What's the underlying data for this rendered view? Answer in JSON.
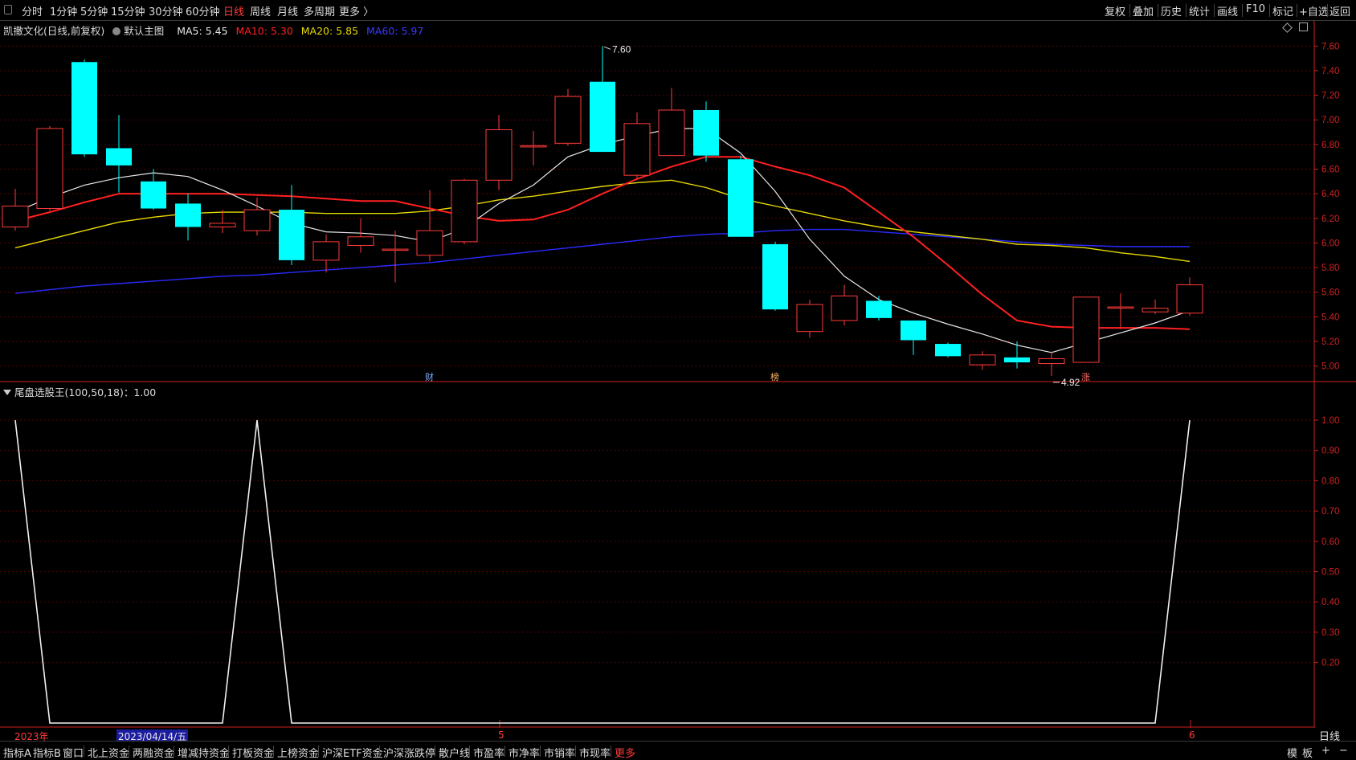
{
  "toolbar": {
    "timeframes": [
      "分时",
      "1分钟",
      "5分钟",
      "15分钟",
      "30分钟",
      "60分钟",
      "日线",
      "周线",
      "月线",
      "多周期",
      "更多 〉"
    ],
    "active_timeframe": "日线",
    "right_items": [
      "复权",
      "叠加",
      "历史",
      "统计",
      "画线",
      "F10",
      "标记",
      "+自选",
      "返回"
    ]
  },
  "info": {
    "stock_label": "凯撒文化(日线,前复权)",
    "main_chart_label": "默认主图",
    "ma5": "MA5: 5.45",
    "ma10": "MA10: 5.30",
    "ma20": "MA20: 5.85",
    "ma60": "MA60: 5.97"
  },
  "indicator": {
    "label": "尾盘选股王(100,50,18)：1.00"
  },
  "colors": {
    "up": "#ff3b3b",
    "down": "#00ffff",
    "ma5": "#e8e8e8",
    "ma10": "#ff2020",
    "ma20": "#e6d800",
    "ma60": "#2a2aff",
    "grid": "#5a0000",
    "axis": "#d02020"
  },
  "chart_data": [
    {
      "type": "candlestick",
      "title": "",
      "ylim": [
        4.88,
        7.7
      ],
      "yticks": [
        "7.60",
        "7.40",
        "7.20",
        "7.00",
        "6.80",
        "6.60",
        "6.40",
        "6.20",
        "6.00",
        "5.80",
        "5.60",
        "5.40",
        "5.20",
        "5.00"
      ],
      "grid": true,
      "candles": [
        {
          "o": 6.13,
          "c": 6.3,
          "h": 6.44,
          "l": 6.1
        },
        {
          "o": 6.28,
          "c": 6.93,
          "h": 6.95,
          "l": 6.26
        },
        {
          "o": 7.47,
          "c": 6.72,
          "h": 7.49,
          "l": 6.7
        },
        {
          "o": 6.77,
          "c": 6.63,
          "h": 7.04,
          "l": 6.41
        },
        {
          "o": 6.5,
          "c": 6.28,
          "h": 6.6,
          "l": 6.27
        },
        {
          "o": 6.32,
          "c": 6.13,
          "h": 6.4,
          "l": 6.02
        },
        {
          "o": 6.13,
          "c": 6.16,
          "h": 6.27,
          "l": 6.08
        },
        {
          "o": 6.1,
          "c": 6.27,
          "h": 6.37,
          "l": 6.06
        },
        {
          "o": 6.27,
          "c": 5.86,
          "h": 6.47,
          "l": 5.82
        },
        {
          "o": 5.86,
          "c": 6.01,
          "h": 6.07,
          "l": 5.76
        },
        {
          "o": 5.98,
          "c": 6.05,
          "h": 6.2,
          "l": 5.92
        },
        {
          "o": 5.95,
          "c": 5.95,
          "h": 6.1,
          "l": 5.68
        },
        {
          "o": 5.9,
          "c": 6.1,
          "h": 6.43,
          "l": 5.85
        },
        {
          "o": 6.01,
          "c": 6.51,
          "h": 6.52,
          "l": 5.99
        },
        {
          "o": 6.51,
          "c": 6.92,
          "h": 7.04,
          "l": 6.43
        },
        {
          "o": 6.79,
          "c": 6.79,
          "h": 6.91,
          "l": 6.63
        },
        {
          "o": 6.81,
          "c": 7.19,
          "h": 7.25,
          "l": 6.79
        },
        {
          "o": 7.31,
          "c": 6.74,
          "h": 7.6,
          "l": 6.74
        },
        {
          "o": 6.55,
          "c": 6.97,
          "h": 7.06,
          "l": 6.52
        },
        {
          "o": 6.71,
          "c": 7.08,
          "h": 7.26,
          "l": 6.71
        },
        {
          "o": 7.08,
          "c": 6.71,
          "h": 7.15,
          "l": 6.66
        },
        {
          "o": 6.68,
          "c": 6.05,
          "h": 6.71,
          "l": 6.05
        },
        {
          "o": 5.99,
          "c": 5.46,
          "h": 6.01,
          "l": 5.45
        },
        {
          "o": 5.28,
          "c": 5.5,
          "h": 5.54,
          "l": 5.23
        },
        {
          "o": 5.37,
          "c": 5.57,
          "h": 5.66,
          "l": 5.33
        },
        {
          "o": 5.53,
          "c": 5.39,
          "h": 5.57,
          "l": 5.37
        },
        {
          "o": 5.37,
          "c": 5.21,
          "h": 5.37,
          "l": 5.09
        },
        {
          "o": 5.18,
          "c": 5.08,
          "h": 5.19,
          "l": 5.07
        },
        {
          "o": 5.01,
          "c": 5.09,
          "h": 5.12,
          "l": 4.97
        },
        {
          "o": 5.07,
          "c": 5.03,
          "h": 5.2,
          "l": 4.98
        },
        {
          "o": 5.02,
          "c": 5.06,
          "h": 5.12,
          "l": 4.92
        },
        {
          "o": 5.03,
          "c": 5.56,
          "h": 5.56,
          "l": 5.03
        },
        {
          "o": 5.48,
          "c": 5.48,
          "h": 5.59,
          "l": 5.3
        },
        {
          "o": 5.44,
          "c": 5.47,
          "h": 5.54,
          "l": 5.42
        },
        {
          "o": 5.43,
          "c": 5.66,
          "h": 5.72,
          "l": 5.41
        }
      ],
      "ma5": [
        6.25,
        6.37,
        6.47,
        6.53,
        6.57,
        6.54,
        6.43,
        6.3,
        6.16,
        6.09,
        6.08,
        6.06,
        6.01,
        6.12,
        6.32,
        6.47,
        6.7,
        6.8,
        6.87,
        6.93,
        6.93,
        6.73,
        6.42,
        6.03,
        5.73,
        5.54,
        5.43,
        5.34,
        5.26,
        5.17,
        5.11,
        5.19,
        5.27,
        5.35,
        5.45
      ],
      "ma10": [
        6.18,
        6.25,
        6.33,
        6.4,
        6.4,
        6.4,
        6.4,
        6.39,
        6.38,
        6.36,
        6.34,
        6.34,
        6.28,
        6.22,
        6.18,
        6.19,
        6.27,
        6.4,
        6.52,
        6.62,
        6.7,
        6.7,
        6.62,
        6.55,
        6.45,
        6.25,
        6.05,
        5.82,
        5.58,
        5.37,
        5.32,
        5.31,
        5.31,
        5.31,
        5.3
      ],
      "ma20": [
        5.96,
        6.03,
        6.1,
        6.17,
        6.21,
        6.24,
        6.25,
        6.25,
        6.25,
        6.24,
        6.24,
        6.24,
        6.26,
        6.3,
        6.35,
        6.38,
        6.42,
        6.46,
        6.49,
        6.51,
        6.45,
        6.36,
        6.3,
        6.24,
        6.18,
        6.13,
        6.09,
        6.06,
        6.03,
        5.99,
        5.98,
        5.96,
        5.92,
        5.89,
        5.85
      ],
      "ma60": [
        5.59,
        5.62,
        5.65,
        5.67,
        5.69,
        5.71,
        5.73,
        5.74,
        5.76,
        5.78,
        5.8,
        5.82,
        5.84,
        5.87,
        5.9,
        5.93,
        5.96,
        5.99,
        6.02,
        6.05,
        6.07,
        6.08,
        6.1,
        6.11,
        6.11,
        6.09,
        6.07,
        6.05,
        6.03,
        6.01,
        5.99,
        5.98,
        5.97,
        5.97,
        5.97
      ],
      "annotations": [
        {
          "label": "7.60",
          "at_index": 17,
          "value": 7.6
        },
        {
          "label": "4.92",
          "at_index": 30,
          "value": 4.92
        }
      ],
      "event_markers": [
        {
          "label": "财",
          "at_index": 12
        },
        {
          "label": "榜",
          "at_index": 22
        },
        {
          "label": "涨",
          "at_index": 31
        }
      ]
    },
    {
      "type": "line",
      "title": "",
      "ylim": [
        0,
        1.0
      ],
      "yticks": [
        "1.00",
        "0.90",
        "0.80",
        "0.70",
        "0.60",
        "0.50",
        "0.40",
        "0.30",
        "0.20"
      ],
      "series": [
        {
          "values": [
            1,
            0,
            0,
            0,
            0,
            0,
            0,
            1,
            0,
            0,
            0,
            0,
            0,
            0,
            0,
            0,
            0,
            0,
            0,
            0,
            0,
            0,
            0,
            0,
            0,
            0,
            0,
            0,
            0,
            0,
            0,
            0,
            0,
            0,
            1
          ]
        }
      ]
    }
  ],
  "date_labels": {
    "year": "2023年",
    "cursor_date": "2023/04/14/五",
    "month_5": "5",
    "month_6": "6"
  },
  "period_label": "日线",
  "bottom_tabs": [
    "指标A",
    "指标B",
    "窗口",
    "北上资金",
    "两融资金",
    "增减持资金",
    "打板资金",
    "上榜资金",
    "沪深ETF资金",
    "沪深涨跌停",
    "散户线",
    "市盈率",
    "市净率",
    "市销率",
    "市现率",
    "更多"
  ],
  "bottom_right": [
    "模",
    "板",
    "+",
    "−"
  ]
}
